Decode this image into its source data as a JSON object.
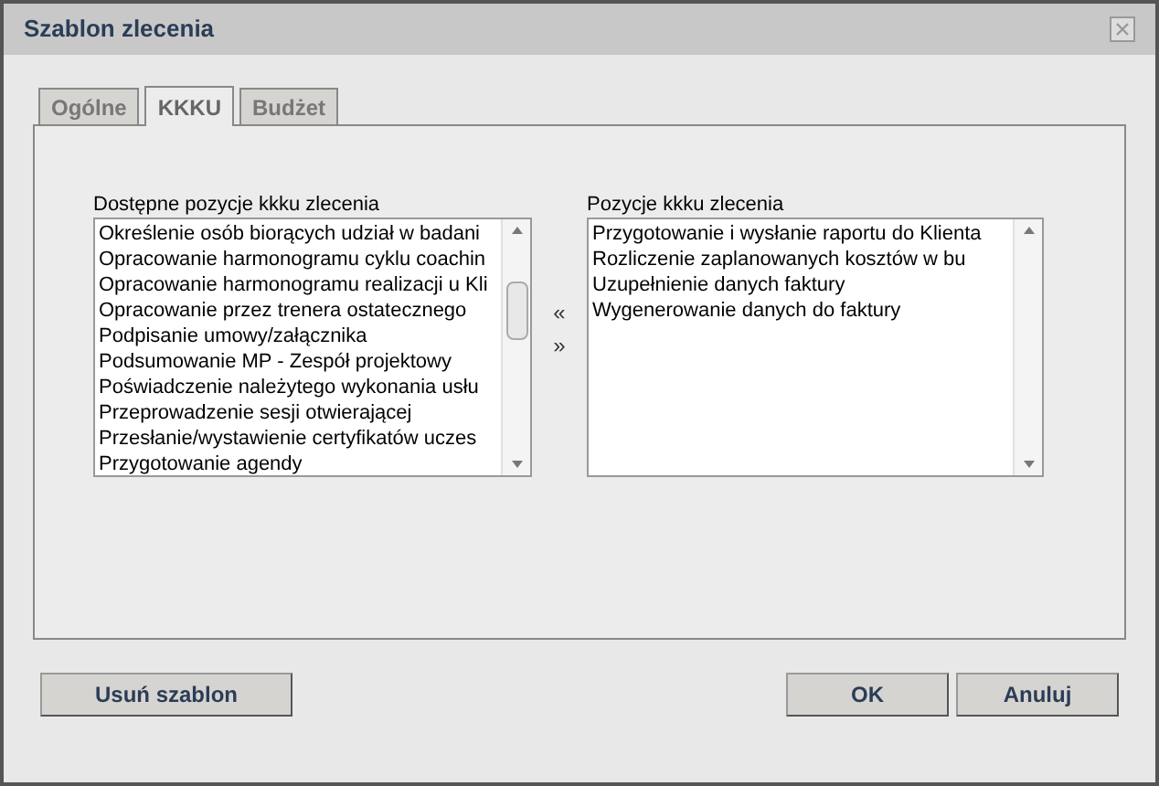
{
  "window": {
    "title": "Szablon zlecenia"
  },
  "tabs": [
    {
      "label": "Ogólne",
      "selected": false
    },
    {
      "label": "KKKU",
      "selected": true
    },
    {
      "label": "Budżet",
      "selected": false
    }
  ],
  "available": {
    "label": "Dostępne pozycje kkku zlecenia",
    "items": [
      "Określenie osób biorących udział w badani",
      "Opracowanie harmonogramu cyklu coachin",
      "Opracowanie harmonogramu realizacji u Kli",
      "Opracowanie przez trenera ostatecznego",
      "Podpisanie umowy/załącznika",
      "Podsumowanie MP - Zespół projektowy",
      "Poświadczenie należytego wykonania usłu",
      "Przeprowadzenie sesji otwierającej",
      "Przesłanie/wystawienie certyfikatów uczes",
      "Przygotowanie agendy"
    ]
  },
  "move_buttons": [
    "«",
    "»"
  ],
  "assigned": {
    "label": "Pozycje kkku zlecenia",
    "items": [
      "Przygotowanie i wysłanie raportu do Klienta",
      "Rozliczenie zaplanowanych kosztów w bu",
      "Uzupełnienie danych faktury",
      "Wygenerowanie danych do faktury"
    ]
  },
  "buttons": {
    "left": [
      "Usuń szablon"
    ],
    "right": [
      "OK",
      "Anuluj"
    ]
  }
}
